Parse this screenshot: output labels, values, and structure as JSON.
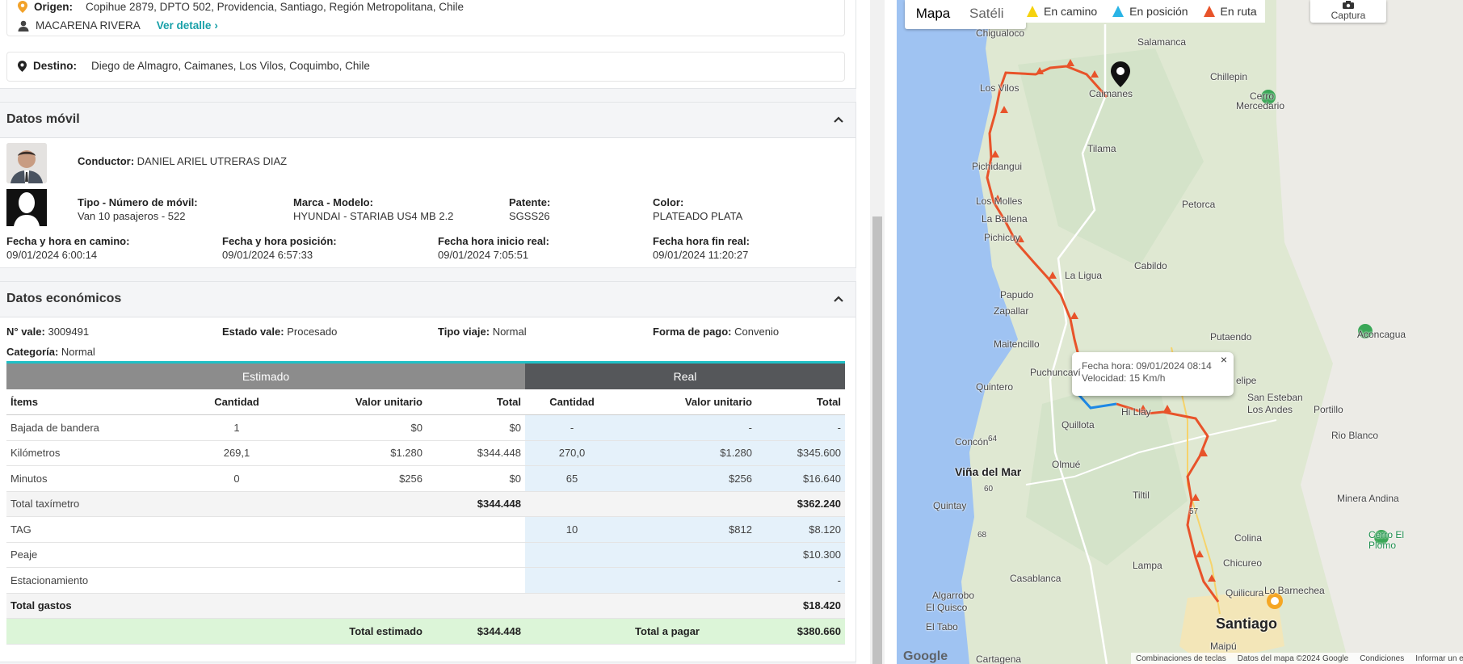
{
  "route": {
    "origin_label": "Origen:",
    "origin": "Copihue 2879, DPTO 502, Providencia, Santiago, Región Metropolitana, Chile",
    "passenger": "MACARENA RIVERA",
    "detail_link": "Ver detalle",
    "destination_label": "Destino:",
    "destination": "Diego de Almagro, Caimanes, Los Vilos, Coquimbo, Chile"
  },
  "mobile": {
    "title": "Datos móvil",
    "driver_label": "Conductor:",
    "driver": "DANIEL ARIEL UTRERAS DIAZ",
    "type_label": "Tipo - Número de móvil:",
    "type": "Van 10 pasajeros - 522",
    "brand_label": "Marca - Modelo:",
    "brand": "HYUNDAI - STARIAB US4 MB 2.2",
    "plate_label": "Patente:",
    "plate": "SGSS26",
    "color_label": "Color:",
    "color": "PLATEADO PLATA",
    "on_way_label": "Fecha y hora en camino:",
    "on_way": "09/01/2024 6:00:14",
    "position_label": "Fecha y hora posición:",
    "position": "09/01/2024 6:57:33",
    "start_label": "Fecha hora inicio real:",
    "start": "09/01/2024 7:05:51",
    "end_label": "Fecha hora fin real:",
    "end": "09/01/2024 11:20:27"
  },
  "econ": {
    "title": "Datos económicos",
    "voucher_label": "N° vale:",
    "voucher": "3009491",
    "state_label": "Estado vale:",
    "state": "Procesado",
    "trip_label": "Tipo viaje:",
    "trip": "Normal",
    "payment_label": "Forma de pago:",
    "payment": "Convenio",
    "category_label": "Categoría:",
    "category": "Normal",
    "band_estimated": "Estimado",
    "band_real": "Real",
    "headers": [
      "Ítems",
      "Cantidad",
      "Valor unitario",
      "Total",
      "Cantidad",
      "Valor unitario",
      "Total"
    ],
    "rows": [
      [
        "Bajada de bandera",
        "1",
        "$0",
        "$0",
        "-",
        "-",
        "-"
      ],
      [
        "Kilómetros",
        "269,1",
        "$1.280",
        "$344.448",
        "270,0",
        "$1.280",
        "$345.600"
      ],
      [
        "Minutos",
        "0",
        "$256",
        "$0",
        "65",
        "$256",
        "$16.640"
      ]
    ],
    "taximeter_label": "Total taxímetro",
    "taximeter_est": "$344.448",
    "taximeter_real": "$362.240",
    "extras": [
      [
        "TAG",
        "10",
        "$812",
        "$8.120"
      ],
      [
        "Peaje",
        "",
        "",
        "$10.300"
      ],
      [
        "Estacionamiento",
        "",
        "",
        "-"
      ]
    ],
    "expenses_label": "Total gastos",
    "expenses": "$18.420",
    "est_total_label": "Total estimado",
    "est_total": "$344.448",
    "pay_total_label": "Total a pagar",
    "pay_total": "$380.660"
  },
  "map": {
    "tab_map": "Mapa",
    "tab_sat": "Satéli",
    "legend": [
      "En camino",
      "En posición",
      "En ruta"
    ],
    "legend_colors": [
      "#f5d20e",
      "#2ab4e6",
      "#e8532a"
    ],
    "capture": "Captura",
    "popup_time": "Fecha hora: 09/01/2024 08:14",
    "popup_speed": "Velocidad: 15 Km/h",
    "places": [
      "Chigualoco",
      "Salamanca",
      "Los Vilos",
      "Caimanes",
      "Chillepin",
      "Cerro",
      "Mercedario",
      "Tilama",
      "Pichidangui",
      "Los Molles",
      "Petorca",
      "La Ballena",
      "Pichicuy",
      "La Ligua",
      "Cabildo",
      "Papudo",
      "Zapallar",
      "Putaendo",
      "Aconcagua",
      "Maitencillo",
      "Puchuncaví",
      "Quintero",
      "elipe",
      "San Esteban",
      "Los Andes",
      "Portillo",
      "Quillota",
      "Hi Llay",
      "Concón",
      "Rio Blanco",
      "Viña del Mar",
      "Olmué",
      "Tiltil",
      "Minera Andina",
      "Quintay",
      "Colina",
      "Cerro El",
      "Plomo",
      "Lampa",
      "Chicureo",
      "Casablanca",
      "Algarrobo",
      "Quilicura",
      "Lo Barnechea",
      "El Quisco",
      "Santiago",
      "El Tabo",
      "Cartagena",
      "Maipú",
      "64",
      "60",
      "68",
      "57"
    ],
    "footer": [
      "Combinaciones de teclas",
      "Datos del mapa ©2024 Google",
      "Condiciones",
      "Informar un er"
    ],
    "google": "Google"
  }
}
